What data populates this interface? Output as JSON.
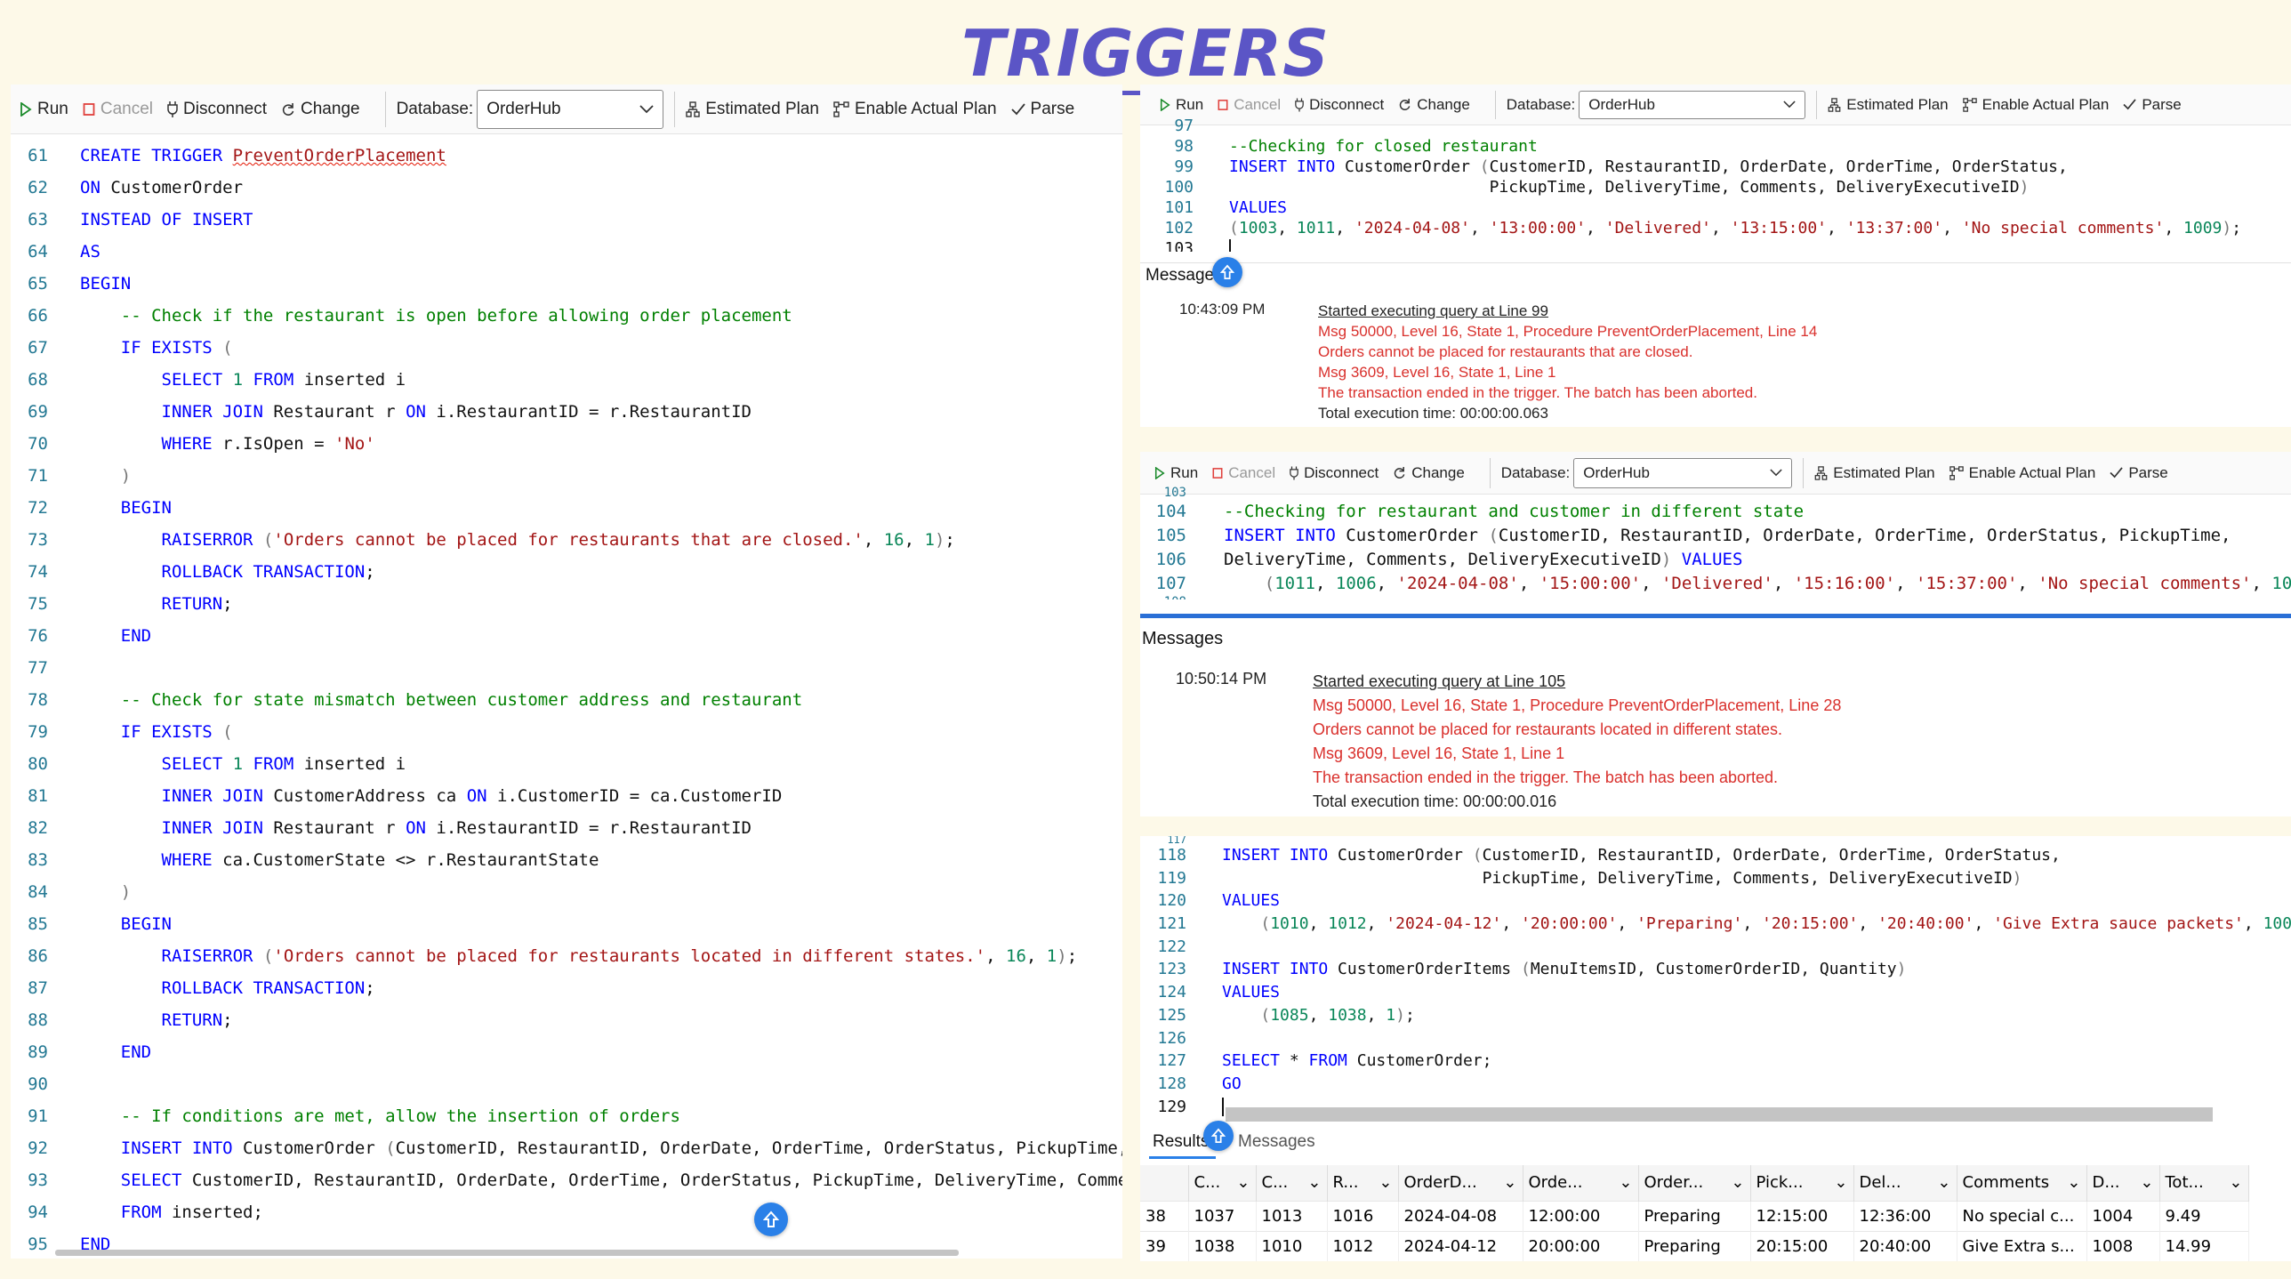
{
  "page_title": "TRIGGERS",
  "toolbar": {
    "run": "Run",
    "cancel": "Cancel",
    "disconnect": "Disconnect",
    "change": "Change",
    "database_label": "Database:",
    "database_value": "OrderHub",
    "estimated_plan": "Estimated Plan",
    "enable_actual_plan": "Enable Actual Plan",
    "parse": "Parse"
  },
  "left_editor": {
    "line_numbers": [
      "61",
      "62",
      "63",
      "64",
      "65",
      "66",
      "67",
      "68",
      "69",
      "70",
      "71",
      "72",
      "73",
      "74",
      "75",
      "76",
      "77",
      "78",
      "79",
      "80",
      "81",
      "82",
      "83",
      "84",
      "85",
      "86",
      "87",
      "88",
      "89",
      "90",
      "91",
      "92",
      "93",
      "94",
      "95"
    ]
  },
  "right_editor_1": {
    "line_numbers": [
      "97",
      "98",
      "99",
      "100",
      "101",
      "102",
      "103"
    ]
  },
  "messages_1": {
    "tab_label": "Messages",
    "time": "10:43:09 PM",
    "lines": [
      "Started executing query at Line 99",
      "Msg 50000, Level 16, State 1, Procedure PreventOrderPlacement, Line 14",
      "Orders cannot be placed for restaurants that are closed.",
      "Msg 3609, Level 16, State 1, Line 1",
      "The transaction ended in the trigger. The batch has been aborted.",
      "Total execution time: 00:00:00.063"
    ]
  },
  "right_editor_2": {
    "line_numbers": [
      "103",
      "104",
      "105",
      "106",
      "107",
      "108"
    ]
  },
  "messages_2": {
    "tab_label": "Messages",
    "time": "10:50:14 PM",
    "lines": [
      "Started executing query at Line 105",
      "Msg 50000, Level 16, State 1, Procedure PreventOrderPlacement, Line 28",
      "Orders cannot be placed for restaurants located in different states.",
      "Msg 3609, Level 16, State 1, Line 1",
      "The transaction ended in the trigger. The batch has been aborted.",
      "Total execution time: 00:00:00.016"
    ]
  },
  "right_editor_3": {
    "line_numbers": [
      "117",
      "118",
      "119",
      "120",
      "121",
      "122",
      "123",
      "124",
      "125",
      "126",
      "127",
      "128",
      "129"
    ]
  },
  "results": {
    "tab_results": "Results",
    "tab_messages": "Messages",
    "columns": [
      "C...",
      "C...",
      "R...",
      "OrderD...",
      "Orde...",
      "Order...",
      "Pick...",
      "Del...",
      "Comments",
      "D...",
      "Tot..."
    ],
    "rows": [
      [
        "38",
        "1037",
        "1013",
        "1016",
        "2024-04-08",
        "12:00:00",
        "Preparing",
        "12:15:00",
        "12:36:00",
        "No special c...",
        "1004",
        "9.49"
      ],
      [
        "39",
        "1038",
        "1010",
        "1012",
        "2024-04-12",
        "20:00:00",
        "Preparing",
        "20:15:00",
        "20:40:00",
        "Give Extra s...",
        "1008",
        "14.99"
      ]
    ]
  },
  "colors": {
    "title": "#5b55c6",
    "keyword": "#0000ff",
    "comment": "#008000",
    "string": "#a31515",
    "number": "#098658",
    "error": "#d9302c",
    "accent": "#2a80e8"
  }
}
